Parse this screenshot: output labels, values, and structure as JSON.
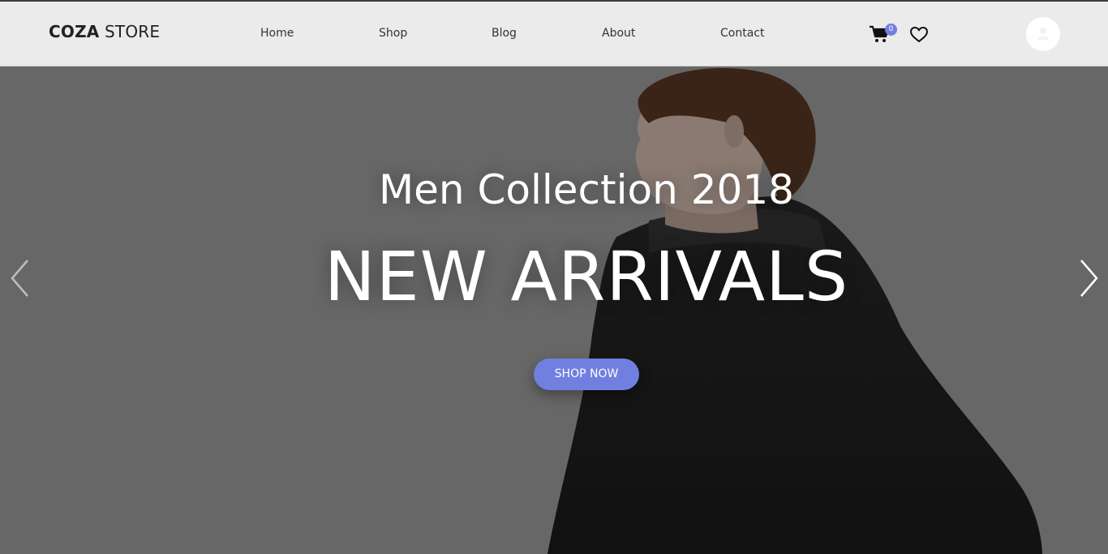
{
  "header": {
    "logo_bold": "COZA",
    "logo_light": " STORE",
    "nav": [
      "Home",
      "Shop",
      "Blog",
      "About",
      "Contact"
    ],
    "cart_count": "0",
    "icons": {
      "cart": "cart-icon",
      "wishlist": "heart-icon",
      "user": "user-avatar"
    }
  },
  "hero": {
    "subtitle": "Men Collection 2018",
    "title": "NEW ARRIVALS",
    "button_label": "SHOP NOW",
    "prev_icon": "chevron-left-icon",
    "next_icon": "chevron-right-icon"
  },
  "colors": {
    "accent": "#717fe0",
    "header_bg": "#ebebeb",
    "hero_bg": "#676767"
  }
}
